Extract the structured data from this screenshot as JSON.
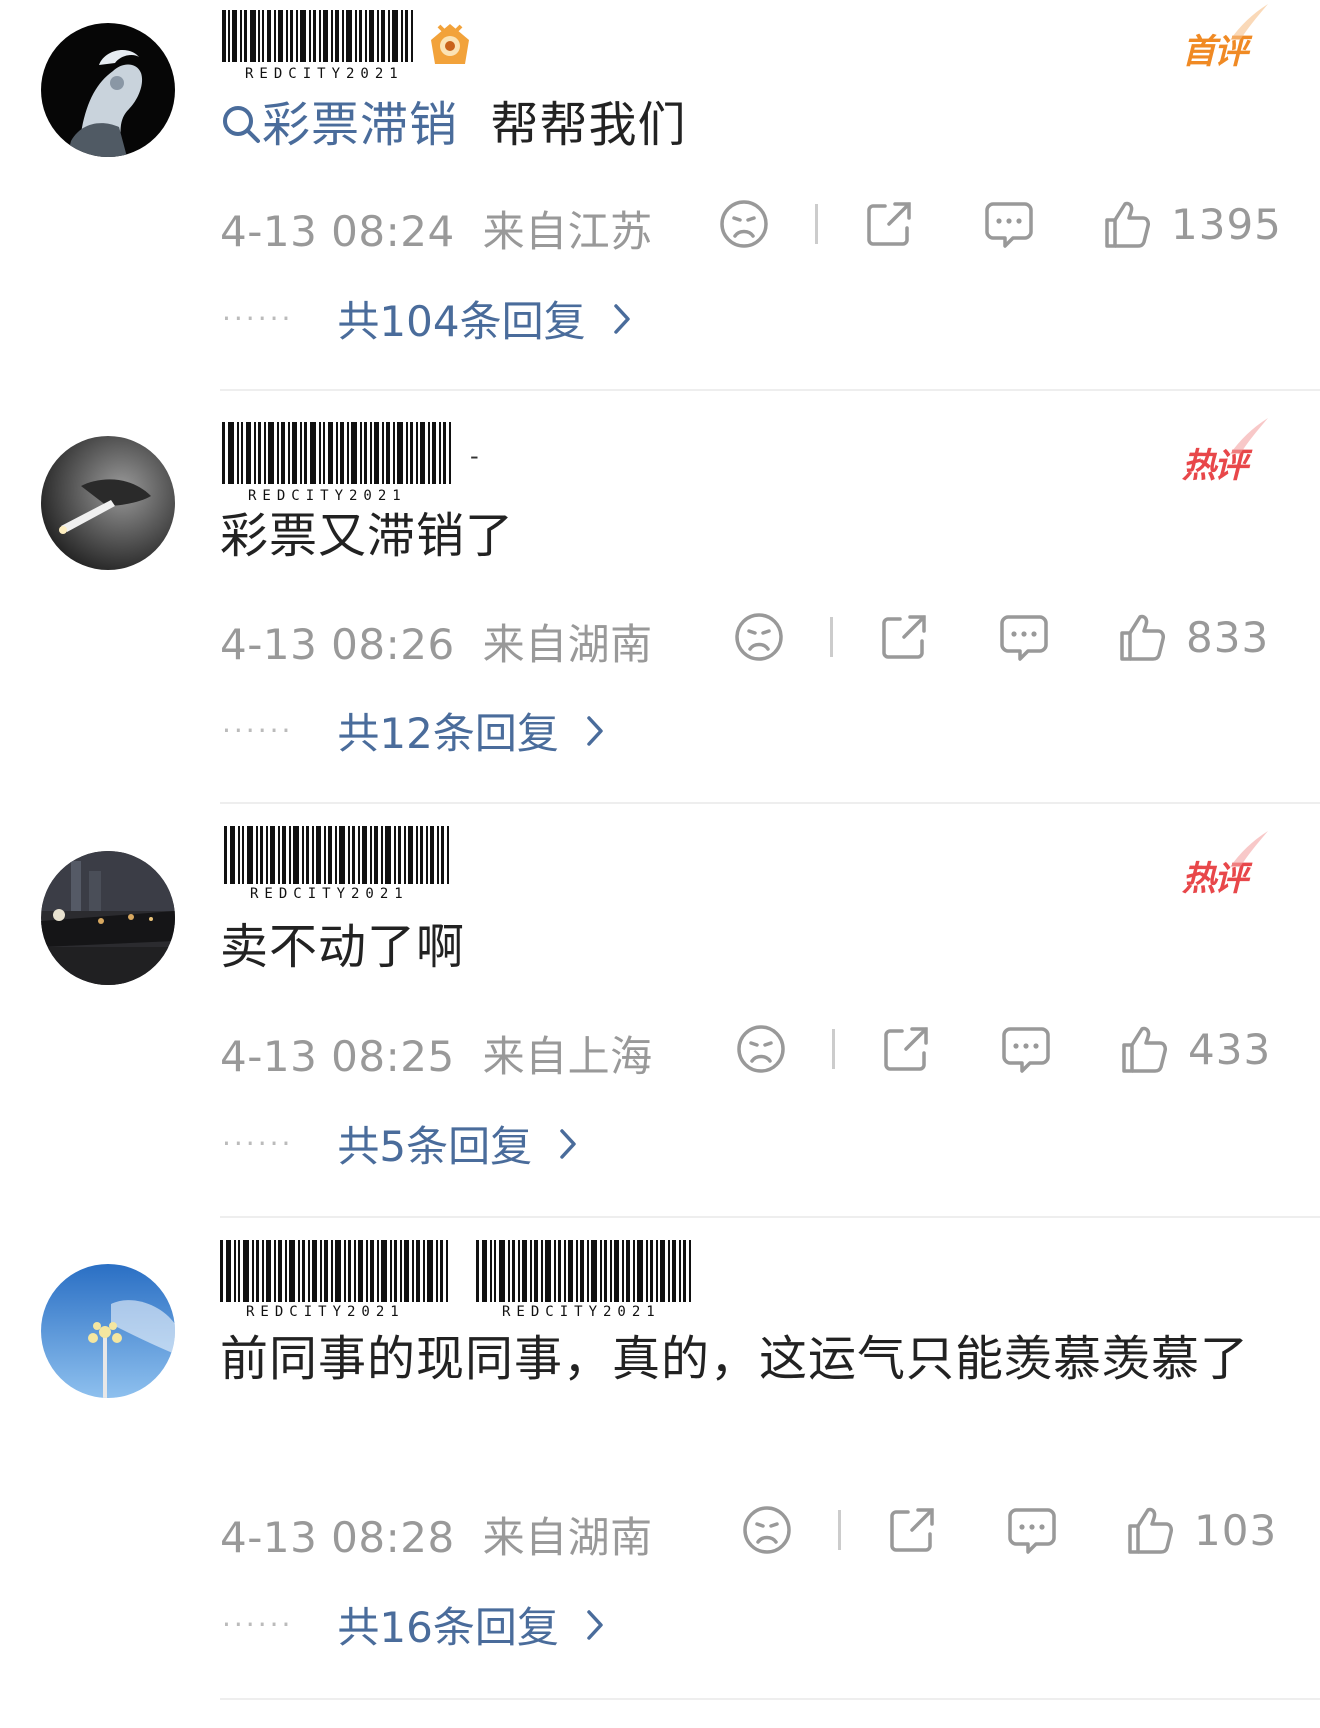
{
  "comments": [
    {
      "watermark": [
        "REDCITY2021"
      ],
      "has_level_badge": true,
      "badge": "首评",
      "badge_color": "#f08a24",
      "search_prefix": "彩票滞销",
      "text": "帮帮我们",
      "time": "4-13 08:24",
      "location": "来自江苏",
      "likes": "1395",
      "dots": "······",
      "replies": "共104条回复"
    },
    {
      "watermark": [
        "REDCITY2021"
      ],
      "name_suffix": "-",
      "badge": "热评",
      "badge_color": "#e8474a",
      "text": "彩票又滞销了",
      "time": "4-13 08:26",
      "location": "来自湖南",
      "likes": "833",
      "dots": "······",
      "replies": "共12条回复"
    },
    {
      "watermark": [
        "REDCITY2021"
      ],
      "badge": "热评",
      "badge_color": "#e8474a",
      "text": "卖不动了啊",
      "time": "4-13 08:25",
      "location": "来自上海",
      "likes": "433",
      "dots": "······",
      "replies": "共5条回复"
    },
    {
      "watermark": [
        "REDCITY2021",
        "REDCITY2021"
      ],
      "text": "前同事的现同事，真的，这运气只能羡慕羡慕了",
      "time": "4-13 08:28",
      "location": "来自湖南",
      "likes": "103",
      "dots": "······",
      "replies": "共16条回复"
    }
  ],
  "icons": [
    "dislike-face-icon",
    "share-icon",
    "comment-bubble-icon",
    "thumbs-up-icon",
    "chevron-right-icon"
  ],
  "colors": {
    "link": "#4a6c9b",
    "meta": "#999999",
    "first_badge": "#f08a24",
    "hot_badge": "#e8474a"
  }
}
